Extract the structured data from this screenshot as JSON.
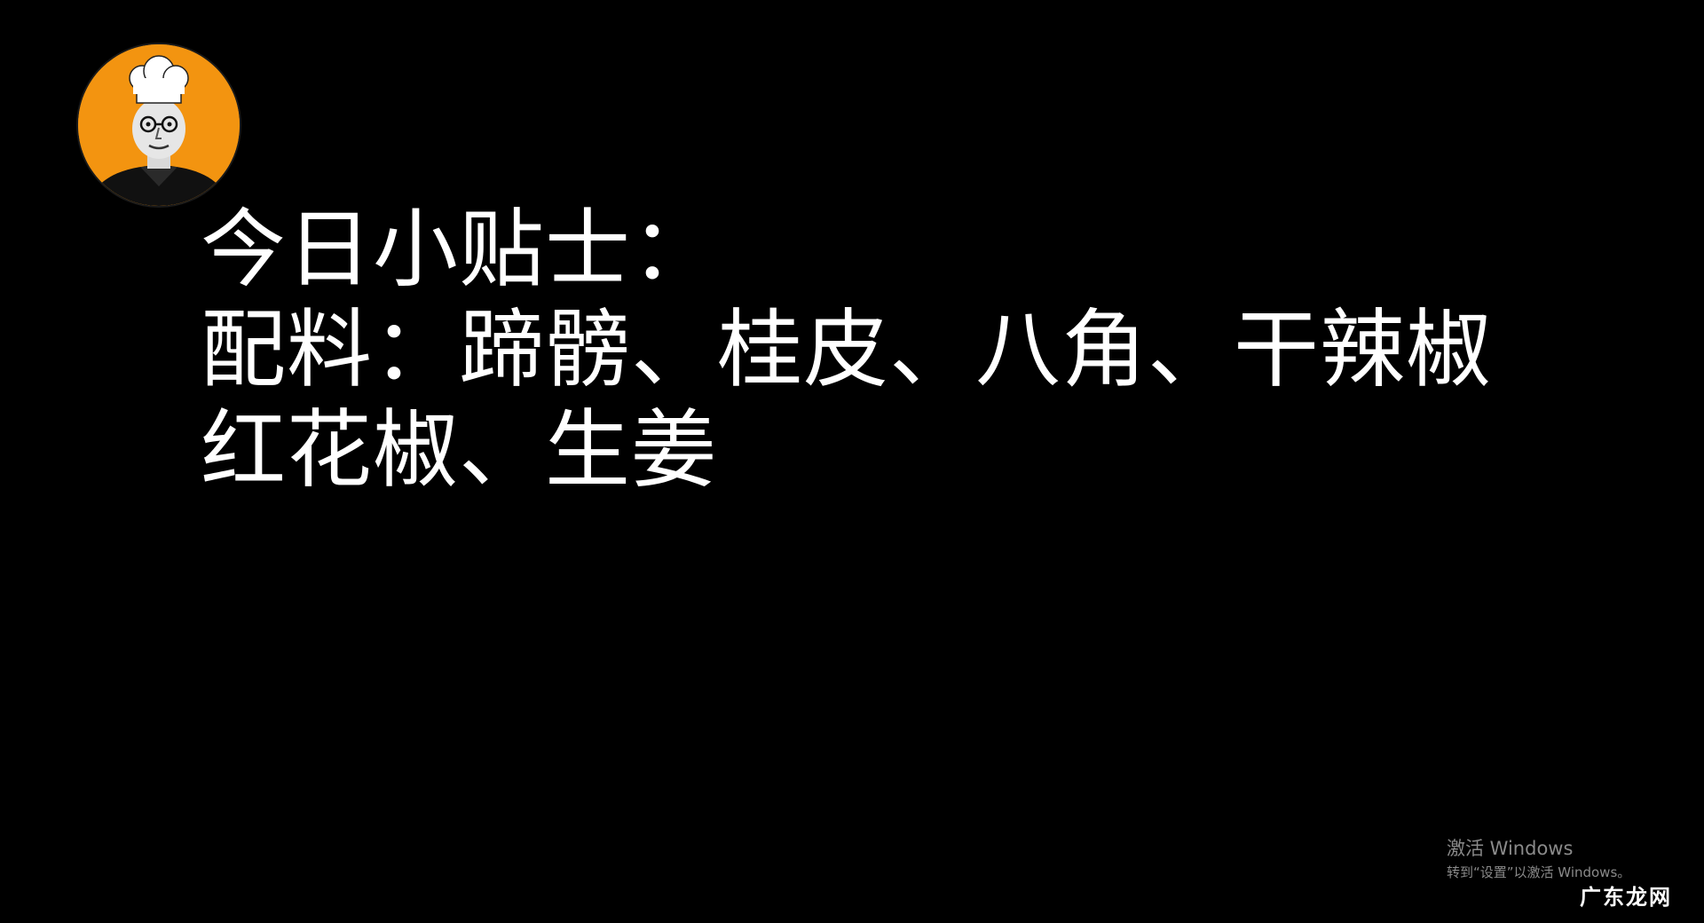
{
  "avatar": {
    "icon": "chef-avatar-icon",
    "bg_color": "#f39410"
  },
  "tips": {
    "lines": [
      "今日小贴士：",
      "配料：蹄髈、桂皮、八角、干辣椒",
      "红花椒、生姜"
    ]
  },
  "activation": {
    "title": "激活 Windows",
    "subtitle": "转到“设置”以激活 Windows。"
  },
  "watermark": {
    "text": "广东龙网"
  }
}
